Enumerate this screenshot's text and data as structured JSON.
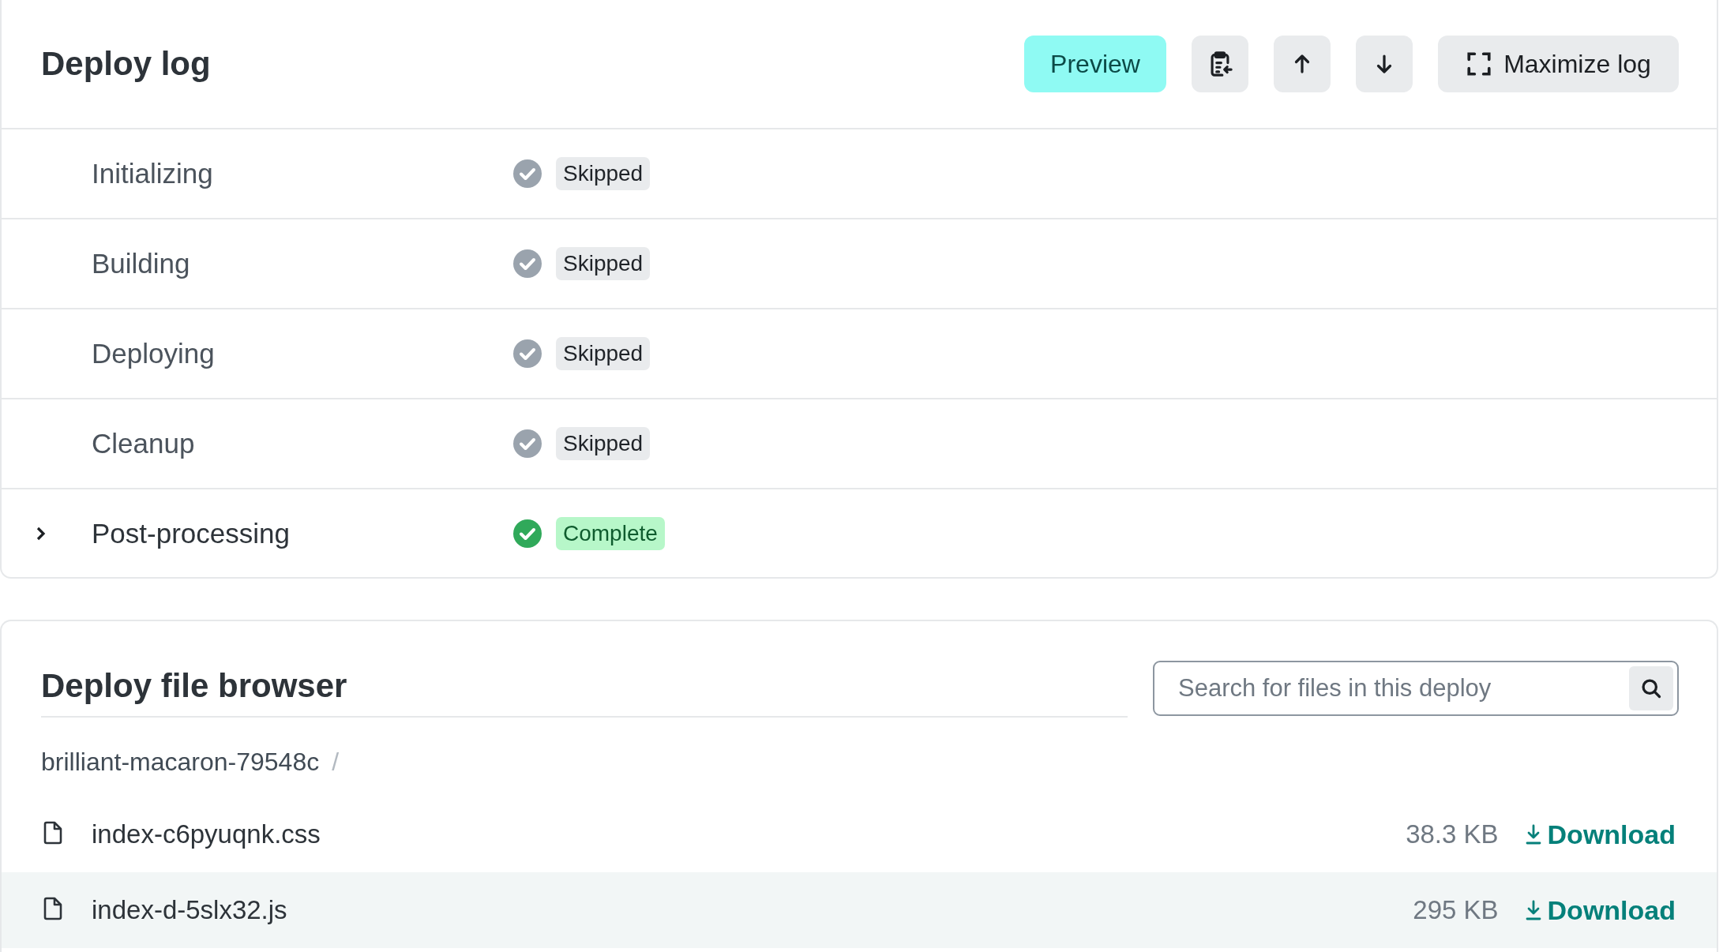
{
  "deploy_log": {
    "title": "Deploy log",
    "toolbar": [
      {
        "kind": "primary",
        "label": "Preview"
      },
      {
        "kind": "icon"
      },
      {
        "kind": "icon"
      },
      {
        "kind": "icon"
      },
      {
        "kind": "icon-text",
        "label": "Maximize log"
      }
    ],
    "steps": [
      {
        "name": "Initializing",
        "status": "Skipped",
        "kind": "skipped",
        "expandable": false
      },
      {
        "name": "Building",
        "status": "Skipped",
        "kind": "skipped",
        "expandable": false
      },
      {
        "name": "Deploying",
        "status": "Skipped",
        "kind": "skipped",
        "expandable": false
      },
      {
        "name": "Cleanup",
        "status": "Skipped",
        "kind": "skipped",
        "expandable": false
      },
      {
        "name": "Post-processing",
        "status": "Complete",
        "kind": "complete",
        "expandable": true
      }
    ]
  },
  "file_browser": {
    "title": "Deploy file browser",
    "search": {
      "placeholder": "Search for files in this deploy"
    },
    "breadcrumb": [
      "brilliant-macaron-79548c"
    ],
    "breadcrumb_separator": "/",
    "files": [
      {
        "name": "index-c6pyuqnk.css",
        "size": "38.3 KB",
        "action": "Download",
        "hovered": false
      },
      {
        "name": "index-d-5slx32.js",
        "size": "295 KB",
        "action": "Download",
        "hovered": true
      }
    ]
  }
}
